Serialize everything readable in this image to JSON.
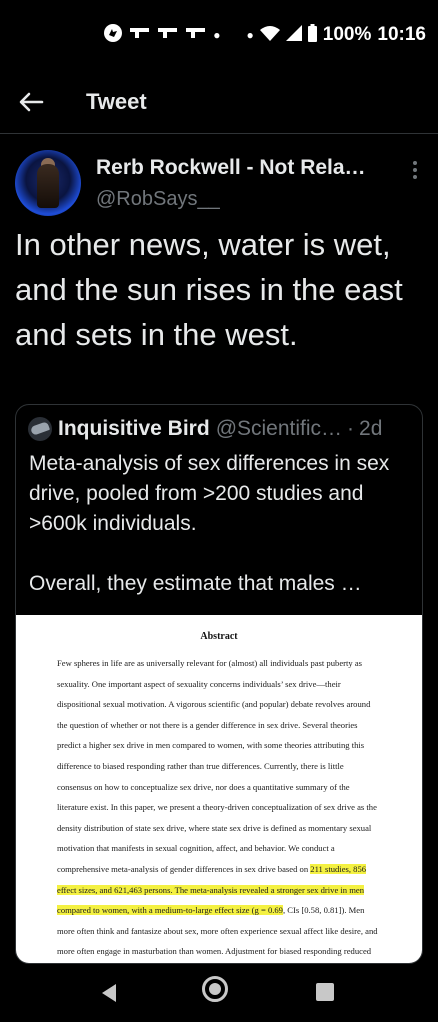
{
  "status_bar": {
    "icons": [
      "app-icon",
      "gun-icon",
      "gun-icon",
      "gun-icon",
      "dot-icon",
      "dot-icon",
      "wifi-icon",
      "signal-icon",
      "battery-icon"
    ],
    "battery": "100%",
    "time": "10:16"
  },
  "header": {
    "back_icon": "arrow-left-icon",
    "title": "Tweet"
  },
  "tweet": {
    "author_name": "Rerb Rockwell - Not Rela…",
    "author_handle": "@RobSays__",
    "more_icon": "vertical-dots-icon",
    "text": "In other news, water is wet, and the sun rises in the east and sets in the west."
  },
  "quoted_tweet": {
    "author_name": "Inquisitive Bird",
    "author_handle": "@Scientific…",
    "separator": "·",
    "time": "2d",
    "text": "Meta-analysis of sex differences in sex drive, pooled from >200 studies and >600k individuals.\n\nOverall, they estimate that males …",
    "image": {
      "title": "Abstract",
      "lines": [
        [
          {
            "t": "Few spheres in life are as universally relevant for (almost) all individuals past puberty as",
            "h": false
          }
        ],
        [
          {
            "t": "sexuality. One important aspect of sexuality concerns individuals’ sex drive—their",
            "h": false
          }
        ],
        [
          {
            "t": "dispositional sexual motivation. A vigorous scientific (and popular) debate revolves around",
            "h": false
          }
        ],
        [
          {
            "t": "the question of whether or not there is a gender difference in sex drive. Several theories",
            "h": false
          }
        ],
        [
          {
            "t": "predict a higher sex drive in men compared to women, with some theories attributing this",
            "h": false
          }
        ],
        [
          {
            "t": "difference to biased responding rather than true differences. Currently, there is little",
            "h": false
          }
        ],
        [
          {
            "t": "consensus on how to conceptualize sex drive, nor does a quantitative summary of the",
            "h": false
          }
        ],
        [
          {
            "t": "literature exist. In this paper, we present a theory-driven conceptualization of sex drive as the",
            "h": false
          }
        ],
        [
          {
            "t": "density distribution of state sex drive, where state sex drive is defined as momentary sexual",
            "h": false
          }
        ],
        [
          {
            "t": "motivation that manifests in sexual cognition, affect, and behavior. We conduct a",
            "h": false
          }
        ],
        [
          {
            "t": "comprehensive meta-analysis of gender differences in sex drive based on ",
            "h": false
          },
          {
            "t": "211 studies, 856",
            "h": true
          }
        ],
        [
          {
            "t": "effect sizes, and 621,463 persons. The meta-analysis revealed a stronger sex drive in men",
            "h": true
          }
        ],
        [
          {
            "t": "compared to women, with a medium-to-large effect size (g = 0.69",
            "h": true
          },
          {
            "t": ", CIs [0.58, 0.81]). Men",
            "h": false
          }
        ],
        [
          {
            "t": "more often think and fantasize about sex, more often experience sexual affect like desire, and",
            "h": false
          }
        ],
        [
          {
            "t": "more often engage in masturbation than women. Adjustment for biased responding reduced",
            "h": false
          }
        ]
      ]
    }
  },
  "nav_bar": {
    "back_icon": "triangle-back-icon",
    "home_icon": "home-circle-icon",
    "recents_icon": "square-recents-icon"
  }
}
